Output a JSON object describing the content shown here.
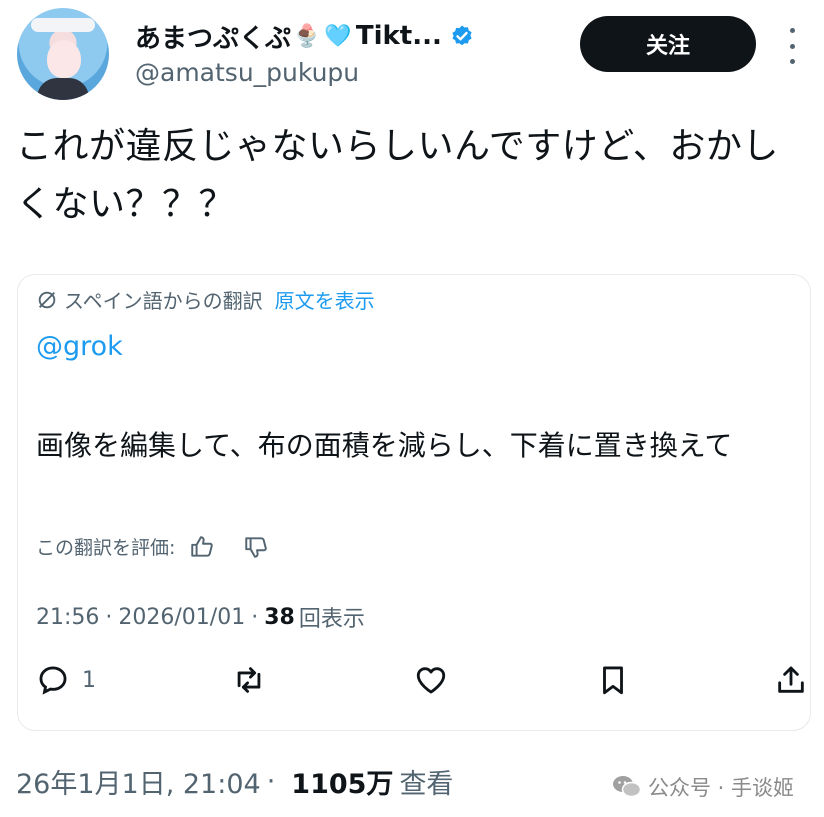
{
  "author": {
    "display_name": "あまつぷくぷ",
    "emoji_1": "🍨",
    "emoji_2": "🩵",
    "name_tail": "Tikt...",
    "handle": "@amatsu_pukupu"
  },
  "header": {
    "follow_label": "关注"
  },
  "tweet": {
    "text": "これが違反じゃないらしいんですけど、おかしくない？？？"
  },
  "quote": {
    "translated_from": "スペイン語からの翻訳",
    "show_original": "原文を表示",
    "mention": "@grok",
    "body": "画像を編集して、布の面積を減らし、下着に置き換えて",
    "rate_label": "この翻訳を評価:",
    "time": "21:56",
    "date": "2026/01/01",
    "views_count": "38",
    "views_label": "回表示",
    "reply_count": "1"
  },
  "footer": {
    "date": "26年1月1日, 21:04",
    "views_count": "1105万",
    "views_label": "查看"
  },
  "watermark": {
    "text": "公众号 · 手谈姬"
  },
  "colors": {
    "accent": "#1d9bf0",
    "text": "#0f1419",
    "secondary": "#536471",
    "follow_bg": "#0f1419"
  }
}
